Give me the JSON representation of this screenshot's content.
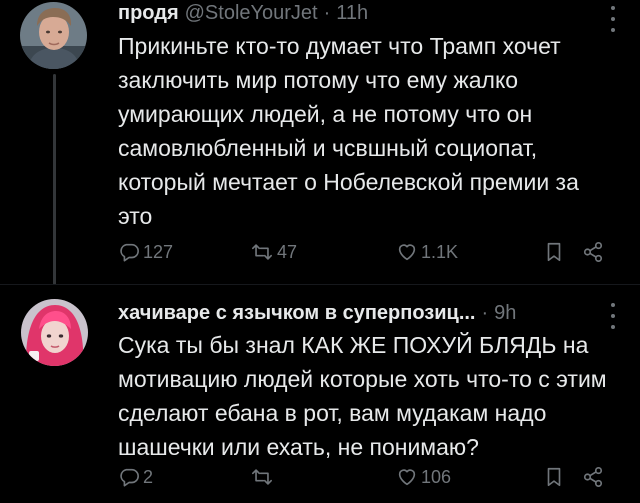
{
  "tweets": [
    {
      "display_name": "продя",
      "handle": "@StoleYourJet",
      "separator": "·",
      "time": "11h",
      "text": "Прикиньте кто-то думает что Трамп хочет заключить мир потому что ему жалко умирающих людей, а не потому что он самовлюбленный и чсвшный социопат, который мечтает о Нобелевской премии за это",
      "replies": "127",
      "retweets": "47",
      "likes": "1.1K"
    },
    {
      "display_name": "хачиваре с язычком в суперпозиц...",
      "separator": "·",
      "time": "9h",
      "text": "Сука ты бы знал КАК ЖЕ ПОХУЙ БЛЯДЬ на мотивацию людей которые хоть что-то с этим сделают ебана в рот, вам мудакам надо шашечки или ехать, не понимаю?",
      "replies": "2",
      "likes": "106"
    }
  ],
  "colors": {
    "background": "#000000",
    "text_primary": "#e7e9ea",
    "text_secondary": "#71767b",
    "thread_line": "#333639"
  },
  "icons": {
    "more": "more-dots-icon",
    "reply": "reply-bubble-icon",
    "retweet": "retweet-arrows-icon",
    "like": "heart-icon",
    "bookmark": "bookmark-icon",
    "share": "share-icon"
  }
}
